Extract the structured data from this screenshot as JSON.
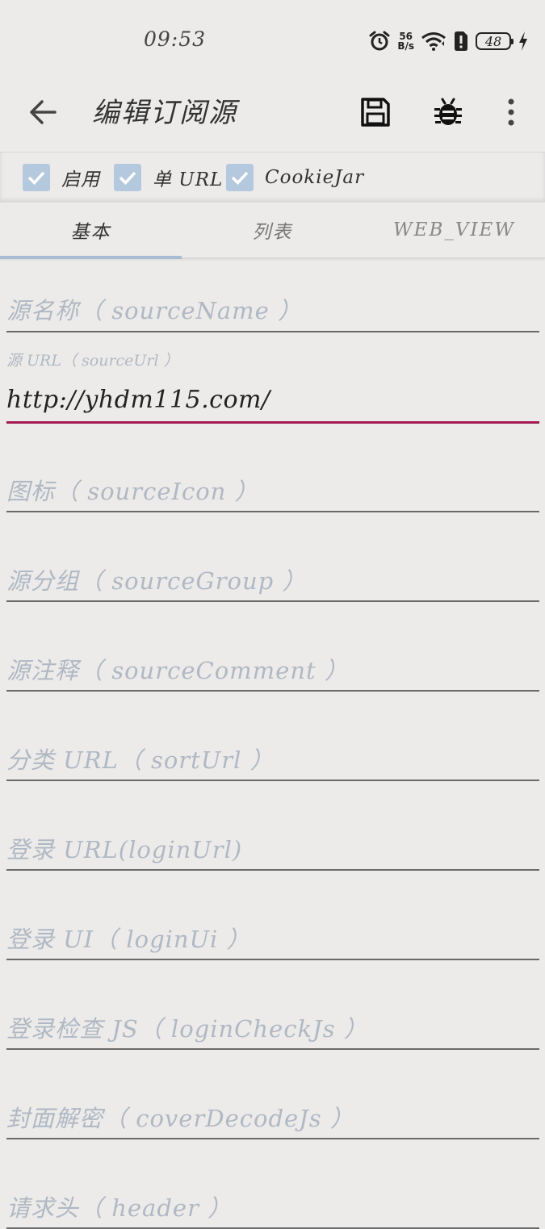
{
  "status_bar": {
    "time": "09:53",
    "net_speed_value": "56",
    "net_speed_unit": "B/s",
    "battery": "48"
  },
  "toolbar": {
    "title": "编辑订阅源"
  },
  "checks": [
    {
      "label": "启用",
      "checked": true
    },
    {
      "label": "单 URL",
      "checked": true
    },
    {
      "label": "CookieJar",
      "checked": true
    }
  ],
  "tabs": [
    {
      "label": "基本",
      "selected": true
    },
    {
      "label": "列表",
      "selected": false
    },
    {
      "label": "WEB_VIEW",
      "selected": false
    }
  ],
  "fields": {
    "source_name": {
      "hint": "源名称（ sourceName ）"
    },
    "source_url": {
      "label": "源 URL（ sourceUrl ）",
      "value": "http://yhdm115.com/"
    },
    "source_icon": {
      "hint": "图标（ sourceIcon ）"
    },
    "source_group": {
      "hint": "源分组（ sourceGroup ）"
    },
    "source_comment": {
      "hint": "源注释（ sourceComment ）"
    },
    "sort_url": {
      "hint": "分类 URL（ sortUrl ）"
    },
    "login_url": {
      "hint": "登录 URL(loginUrl)"
    },
    "login_ui": {
      "hint": "登录 UI（ loginUi ）"
    },
    "login_check_js": {
      "hint": "登录检查 JS（ loginCheckJs ）"
    },
    "cover_decode_js": {
      "hint": "封面解密（ coverDecodeJs ）"
    },
    "header": {
      "hint": "请求头（ header ）"
    }
  },
  "colors": {
    "accent": "#a41953",
    "checkbox": "#b5c9de",
    "tab_indicator": "#a8bcd4",
    "hint_text": "#b0b8c3"
  }
}
